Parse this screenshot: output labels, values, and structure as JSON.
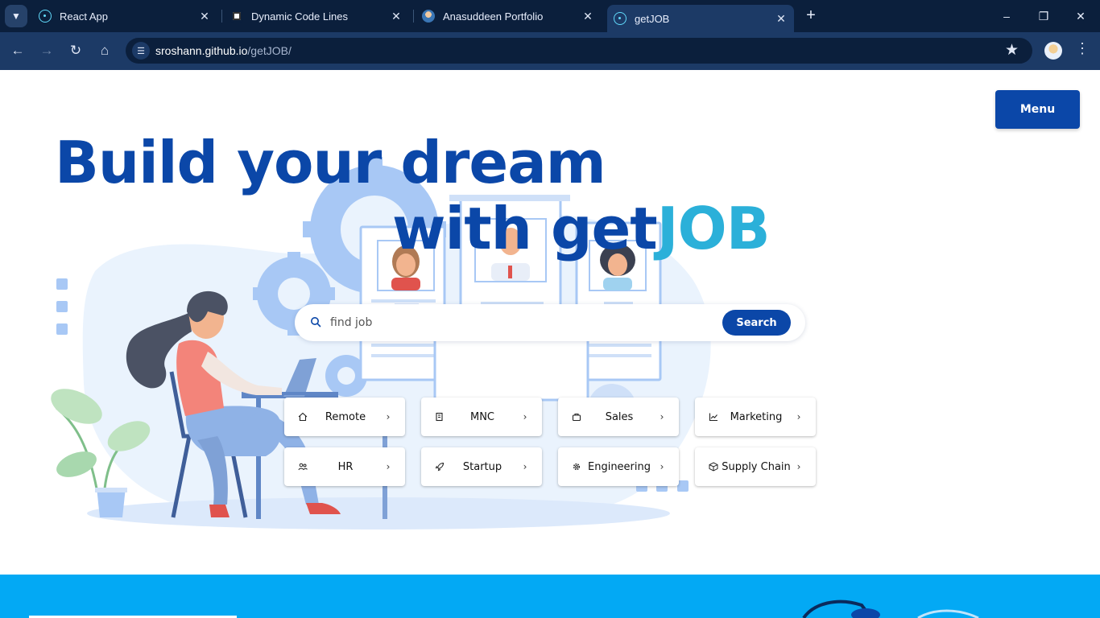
{
  "browser": {
    "tabs": [
      {
        "title": "React App",
        "favicon": "react-icon",
        "active": false
      },
      {
        "title": "Dynamic Code Lines",
        "favicon": "openai-icon",
        "active": false
      },
      {
        "title": "Anasuddeen Portfolio",
        "favicon": "avatar-icon",
        "active": false
      },
      {
        "title": "getJOB",
        "favicon": "react-icon",
        "active": true
      }
    ],
    "url_host": "sroshann.github.io",
    "url_path": "/getJOB/"
  },
  "header": {
    "menu_label": "Menu"
  },
  "hero": {
    "line1": "Build your dream",
    "line2_prefix": "with get",
    "line2_accent": "JOB",
    "accent_color": "#2bb0d9",
    "brand_color": "#0b47a8"
  },
  "search": {
    "placeholder": "find job",
    "button_label": "Search"
  },
  "categories": [
    {
      "label": "Remote",
      "icon": "home-icon"
    },
    {
      "label": "MNC",
      "icon": "building-icon"
    },
    {
      "label": "Sales",
      "icon": "bag-icon"
    },
    {
      "label": "Marketing",
      "icon": "chart-icon"
    },
    {
      "label": "HR",
      "icon": "people-icon"
    },
    {
      "label": "Startup",
      "icon": "rocket-icon"
    },
    {
      "label": "Engineering",
      "icon": "gear-icon"
    },
    {
      "label": "Supply Chain",
      "icon": "box-icon"
    }
  ],
  "footer": {
    "band_color": "#03a9f4"
  }
}
